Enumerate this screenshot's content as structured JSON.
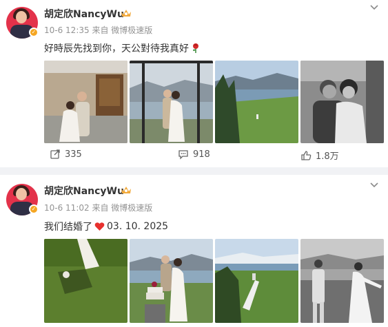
{
  "posts": [
    {
      "author": "胡定欣NancyWu",
      "meta": "10-6 12:35  来自 微博极速版",
      "text": "好時辰先找到你，天公對待我真好",
      "text_emoji": "rose",
      "images": [
        "wedding couple in front of wooden door",
        "couple embracing by lake window",
        "lake landscape with green lawn",
        "black and white couple embracing"
      ],
      "actions": {
        "repost": "335",
        "comment": "918",
        "like": "1.8万"
      }
    },
    {
      "author": "胡定欣NancyWu",
      "meta": "10-6 11:02  来自 微博极速版",
      "text": "我们结婚了",
      "text_emoji": "red-heart",
      "text_date": "03. 10. 2025",
      "images": [
        "bride on grass with shadow",
        "couple cutting wedding cake by lake",
        "lakeside lawn aerial view",
        "black and white couple walking hand in hand"
      ]
    }
  ],
  "colors": {
    "separator": "#f1f2f5",
    "meta_text": "#939393",
    "verified_badge": "#f5a623",
    "heart": "#e8312e"
  }
}
